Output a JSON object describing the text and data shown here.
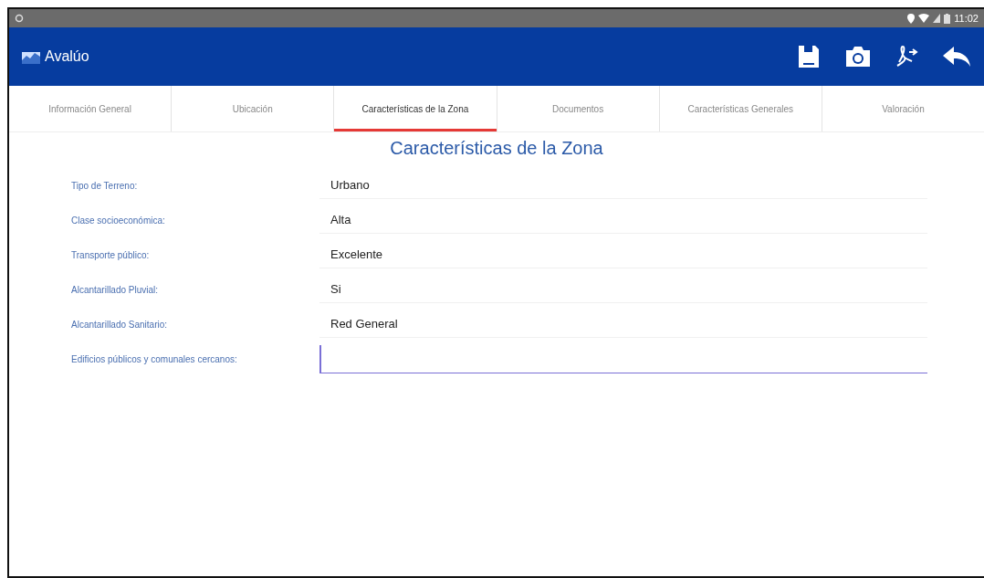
{
  "status_bar": {
    "time": "11:02"
  },
  "app_bar": {
    "title": "Avalúo"
  },
  "tabs": [
    {
      "label": "Información General",
      "selected": false
    },
    {
      "label": "Ubicación",
      "selected": false
    },
    {
      "label": "Características de la Zona",
      "selected": true
    },
    {
      "label": "Documentos",
      "selected": false
    },
    {
      "label": "Características Generales",
      "selected": false
    },
    {
      "label": "Valoración",
      "selected": false
    }
  ],
  "heading": "Características de la Zona",
  "fields": [
    {
      "label": "Tipo de Terreno:",
      "kind": "select",
      "value": "Urbano"
    },
    {
      "label": "Clase socioeconómica:",
      "kind": "select",
      "value": "Alta"
    },
    {
      "label": "Transporte público:",
      "kind": "select",
      "value": "Excelente"
    },
    {
      "label": "Alcantarillado Pluvial:",
      "kind": "select",
      "value": "Si"
    },
    {
      "label": "Alcantarillado Sanitario:",
      "kind": "select",
      "value": "Red General"
    },
    {
      "label": "Edificios públicos y comunales cercanos:",
      "kind": "input",
      "focused": true
    }
  ]
}
